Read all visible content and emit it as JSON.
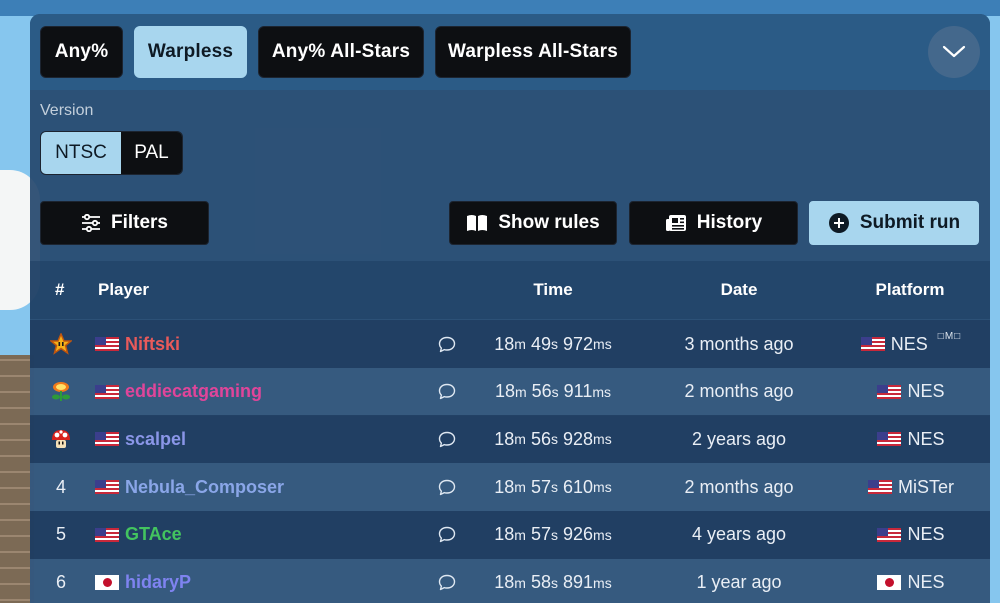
{
  "categories": [
    {
      "label": "Any%",
      "active": false
    },
    {
      "label": "Warpless",
      "active": true
    },
    {
      "label": "Any% All-Stars",
      "active": false
    },
    {
      "label": "Warpless All-Stars",
      "active": false
    }
  ],
  "version": {
    "label": "Version",
    "options": [
      "NTSC",
      "PAL"
    ],
    "selected": "NTSC"
  },
  "toolbar": {
    "filters": "Filters",
    "show_rules": "Show rules",
    "history": "History",
    "submit_run": "Submit run"
  },
  "table": {
    "headers": {
      "rank": "#",
      "player": "Player",
      "time": "Time",
      "date": "Date",
      "platform": "Platform"
    },
    "rows": [
      {
        "rank": "",
        "trophy": "star",
        "flag": "us",
        "player": "Niftski",
        "color": "#e85a5a",
        "time": {
          "m": "18",
          "s": "49",
          "ms": "972"
        },
        "date": "3 months ago",
        "platform_flag": "us",
        "platform": "NES",
        "tags": "□M□"
      },
      {
        "rank": "",
        "trophy": "fire-flower",
        "flag": "us",
        "player": "eddiecatgaming",
        "color": "#e0459a",
        "time": {
          "m": "18",
          "s": "56",
          "ms": "911"
        },
        "date": "2 months ago",
        "platform_flag": "us",
        "platform": "NES",
        "tags": ""
      },
      {
        "rank": "",
        "trophy": "mushroom",
        "flag": "us",
        "player": "scalpel",
        "color": "#8a96e8",
        "time": {
          "m": "18",
          "s": "56",
          "ms": "928"
        },
        "date": "2 years ago",
        "platform_flag": "us",
        "platform": "NES",
        "tags": ""
      },
      {
        "rank": "4",
        "trophy": "",
        "flag": "us",
        "player": "Nebula_Composer",
        "color": "#8aa6e8",
        "time": {
          "m": "18",
          "s": "57",
          "ms": "610"
        },
        "date": "2 months ago",
        "platform_flag": "us",
        "platform": "MiSTer",
        "tags": ""
      },
      {
        "rank": "5",
        "trophy": "",
        "flag": "us",
        "player": "GTAce",
        "color": "#43c45f",
        "time": {
          "m": "18",
          "s": "57",
          "ms": "926"
        },
        "date": "4 years ago",
        "platform_flag": "us",
        "platform": "NES",
        "tags": ""
      },
      {
        "rank": "6",
        "trophy": "",
        "flag": "jp",
        "player": "hidaryP",
        "color": "#7f83f0",
        "time": {
          "m": "18",
          "s": "58",
          "ms": "891"
        },
        "date": "1 year ago",
        "platform_flag": "jp",
        "platform": "NES",
        "tags": ""
      }
    ]
  },
  "units": {
    "m": "m",
    "s": "s",
    "ms": "ms"
  }
}
